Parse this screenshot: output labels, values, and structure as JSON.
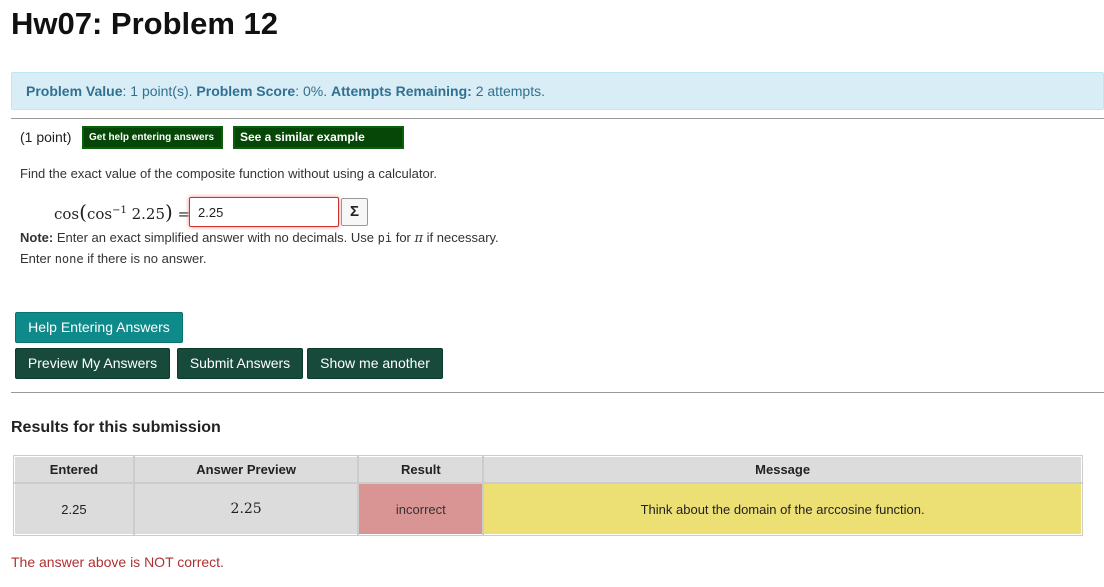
{
  "page": {
    "title": "Hw07: Problem 12"
  },
  "info": {
    "value_label": "Problem Value",
    "value_text": ": 1 point(s). ",
    "score_label": "Problem Score",
    "score_text": ": 0%. ",
    "attempts_label": "Attempts Remaining:",
    "attempts_text": " 2 attempts."
  },
  "problem": {
    "points": "(1 point)",
    "help_small_label": "Get help entering answers",
    "similar_label": "See a similar example (.PDF)",
    "prompt": "Find the exact value of the composite function without using a calculator.",
    "expr_cos": "cos",
    "expr_open": "(",
    "expr_inner": "cos",
    "expr_sup": "−1",
    "expr_arg": " 2.25",
    "expr_close": ")",
    "expr_eq": " =",
    "answer_value": "2.25",
    "sigma": "Σ",
    "note_label": "Note:",
    "note_text1": " Enter an exact simplified answer with no decimals. Use ",
    "note_pi_code": "pi",
    "note_text2": " for ",
    "note_pi_sym": "π",
    "note_text3": " if necessary.",
    "enter_text1": "Enter ",
    "enter_none": "none",
    "enter_text2": " if there is no answer."
  },
  "buttons": {
    "help": "Help Entering Answers",
    "preview": "Preview My Answers",
    "submit": "Submit Answers",
    "another": "Show me another"
  },
  "results": {
    "title": "Results for this submission",
    "headers": [
      "Entered",
      "Answer Preview",
      "Result",
      "Message"
    ],
    "row": {
      "entered": "2.25",
      "preview": "2.25",
      "result": "incorrect",
      "message": "Think about the domain of the arccosine function."
    },
    "status": "The answer above is NOT correct."
  },
  "colors": {
    "info_bg": "#d9edf7",
    "result_bg": "#d99494",
    "message_bg": "#ece075",
    "button_dark": "#174a3a",
    "button_teal": "#0e8a8a"
  }
}
